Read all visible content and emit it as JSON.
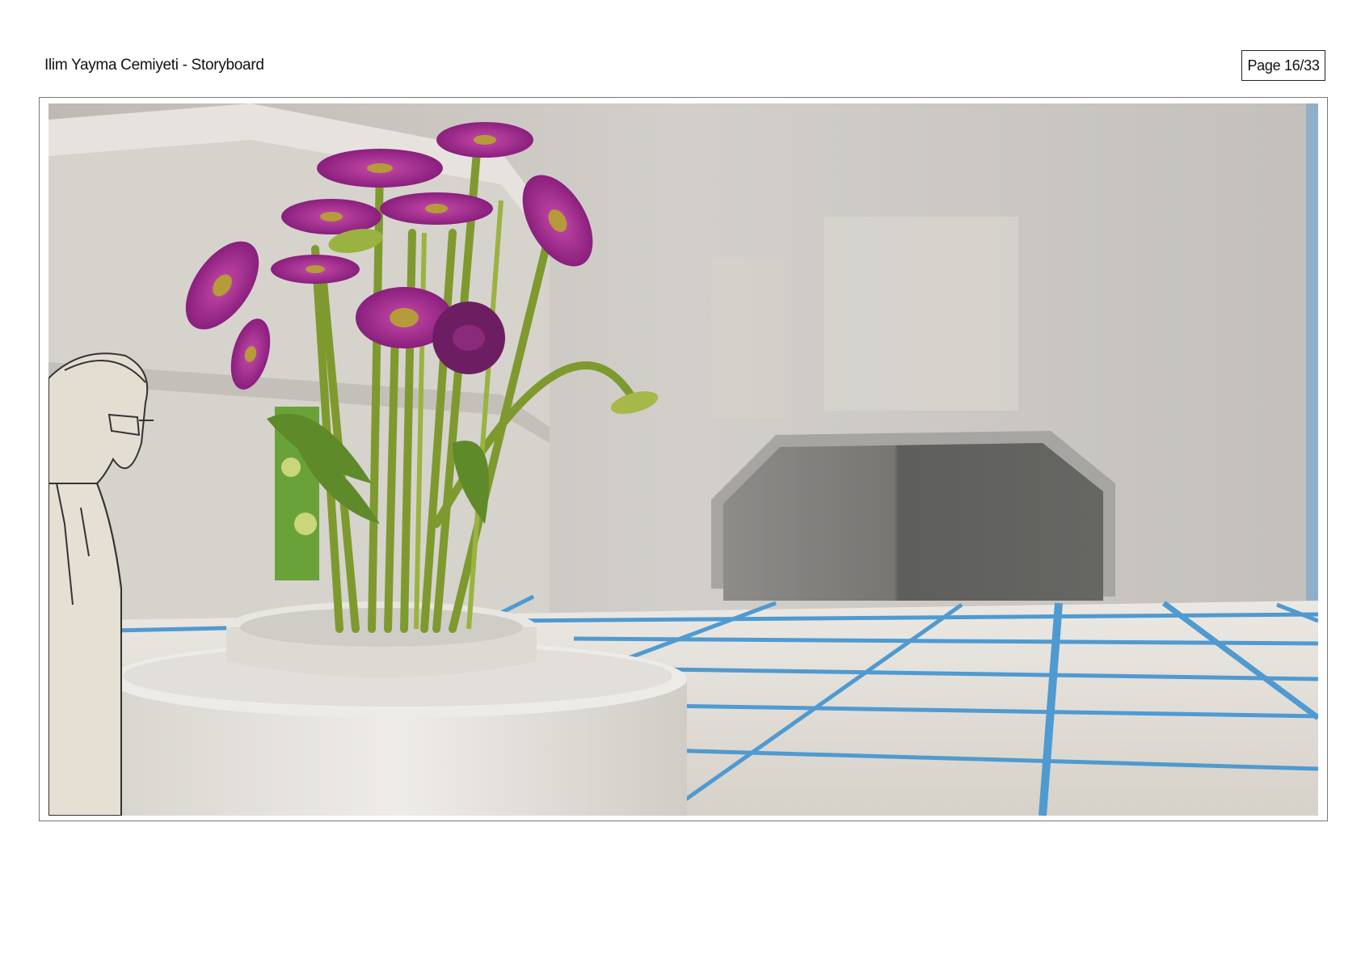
{
  "header": {
    "title": "Ilim Yayma Cemiyeti - Storyboard",
    "page_label": "Page 16/33"
  },
  "panel": {
    "frame_number": 16,
    "icons": [
      "flower-vase-illustration",
      "character-sketch",
      "doorway",
      "tiled-floor"
    ],
    "colors": {
      "wall": "#c8c4be",
      "floor": "#dedad3",
      "tile_lines": "#4f9ad0",
      "door_dark": "#5f5f5d",
      "petal": "#a0288f",
      "stem": "#7e9a2e"
    }
  }
}
